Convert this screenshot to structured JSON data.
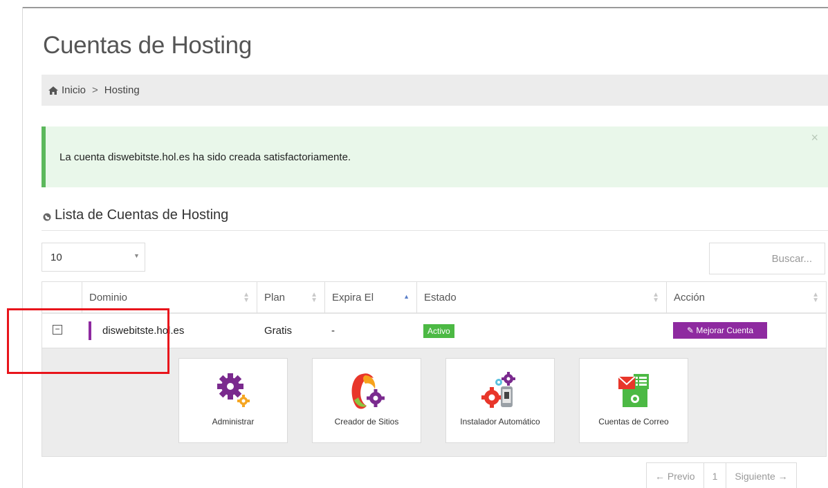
{
  "page": {
    "title": "Cuentas de Hosting"
  },
  "breadcrumb": {
    "home": "Inicio",
    "separator": ">",
    "current": "Hosting"
  },
  "alert": {
    "message": "La cuenta diswebitste.hol.es ha sido creada satisfactoriamente.",
    "close": "×"
  },
  "list": {
    "title": "Lista de Cuentas de Hosting"
  },
  "controls": {
    "page_length": "10",
    "search_placeholder": "Buscar..."
  },
  "table": {
    "headers": {
      "domain": "Dominio",
      "plan": "Plan",
      "expires": "Expira El",
      "status": "Estado",
      "action": "Acción"
    },
    "rows": [
      {
        "domain": "diswebitste.hol.es",
        "plan": "Gratis",
        "expires": "-",
        "status": "Activo",
        "action": "Mejorar Cuenta"
      }
    ]
  },
  "tools": [
    {
      "label": "Administrar",
      "icon": "gears-icon"
    },
    {
      "label": "Creador de Sitios",
      "icon": "site-builder-icon"
    },
    {
      "label": "Instalador Automático",
      "icon": "auto-installer-icon"
    },
    {
      "label": "Cuentas de Correo",
      "icon": "email-accounts-icon"
    }
  ],
  "pagination": {
    "prev": "← Previo",
    "page": "1",
    "next": "Siguiente →"
  },
  "colors": {
    "accent": "#8e2aa0",
    "success": "#4cb944",
    "alert_bg": "#e9f7ea",
    "alert_border": "#5cb85c",
    "highlight": "#e8141b"
  }
}
